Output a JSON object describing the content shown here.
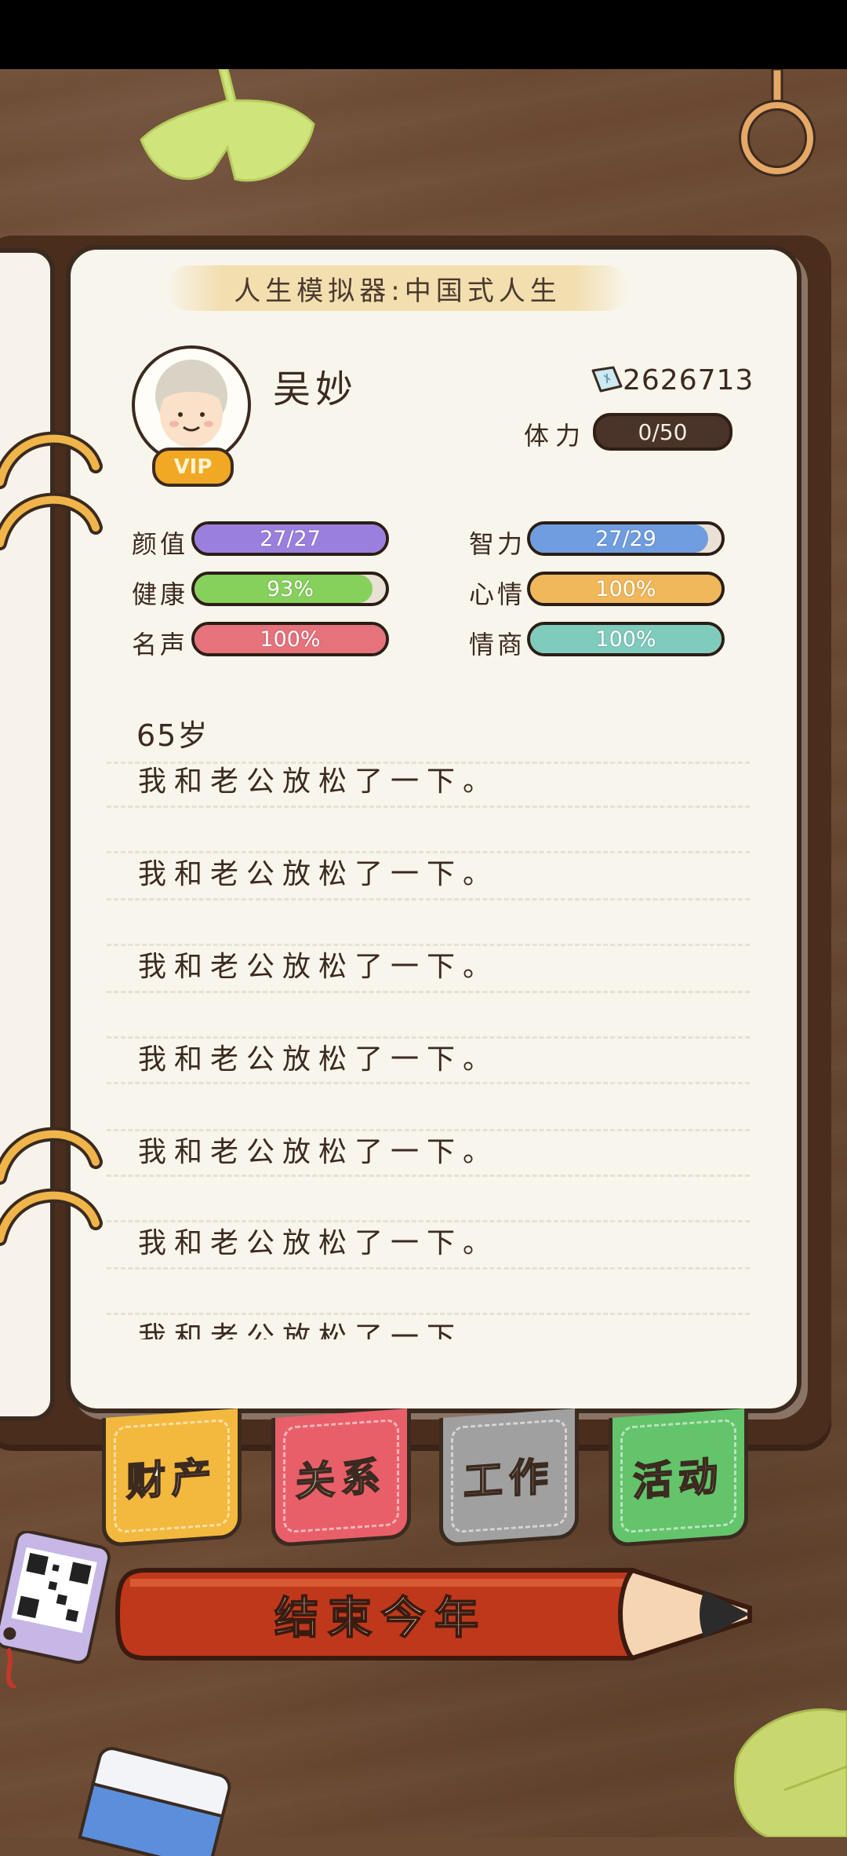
{
  "game_title": "人生模拟器:中国式人生",
  "player": {
    "name": "吴妙",
    "vip_label": "VIP",
    "money": "2626713",
    "stamina_label": "体力",
    "stamina_value": "0/50"
  },
  "stats": {
    "appearance": {
      "label": "颜值",
      "value": "27/27",
      "fraction": 1.0,
      "color": "#9b7fdf"
    },
    "intelligence": {
      "label": "智力",
      "value": "27/29",
      "fraction": 0.93,
      "color": "#6f9de0"
    },
    "health": {
      "label": "健康",
      "value": "93%",
      "fraction": 0.93,
      "color": "#86d05c"
    },
    "mood": {
      "label": "心情",
      "value": "100%",
      "fraction": 1.0,
      "color": "#f0b85a"
    },
    "fame": {
      "label": "名声",
      "value": "100%",
      "fraction": 1.0,
      "color": "#e6727c"
    },
    "eq": {
      "label": "情商",
      "value": "100%",
      "fraction": 1.0,
      "color": "#7fcbbc"
    }
  },
  "log": {
    "age": "65岁",
    "entries": [
      "我和老公放松了一下。",
      "我和老公放松了一下。",
      "我和老公放松了一下。",
      "我和老公放松了一下。",
      "我和老公放松了一下。",
      "我和老公放松了一下。",
      "我和老公放松了一下。"
    ]
  },
  "tabs": {
    "assets": "财产",
    "relations": "关系",
    "work": "工作",
    "activity": "活动"
  },
  "end_year_label": "结束今年",
  "icons": {
    "money": "banknote-icon",
    "avatar": "old-woman-avatar",
    "qr": "qr-code-icon"
  }
}
